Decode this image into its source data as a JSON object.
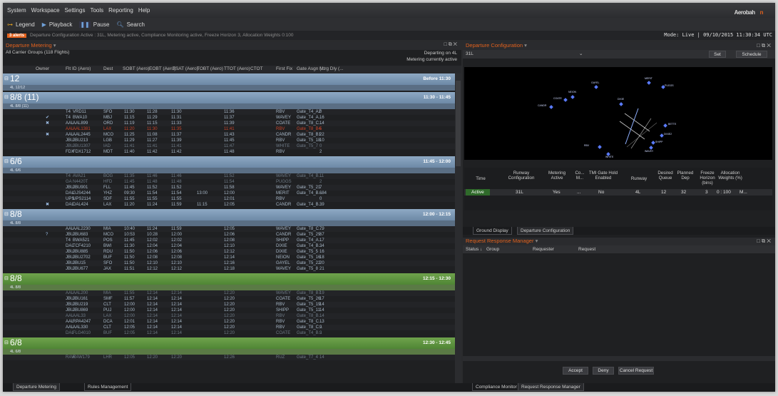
{
  "menu": [
    "System",
    "Workspace",
    "Settings",
    "Tools",
    "Reporting",
    "Help"
  ],
  "brand": {
    "prefix": "Aerobah",
    "suffix": "n"
  },
  "toolbar": {
    "legend": "Legend",
    "playback": "Playback",
    "pause": "Pause",
    "search": "Search"
  },
  "status": {
    "alert": "3 alerts",
    "text": "Departure Configuration Active : 31L, Metering active, Compliance Monitoring active, Freeze Horizon 3, Allocation Weights 0:100",
    "mode": "Mode: Live  |  09/10/2015 11:30:34 UTC"
  },
  "left": {
    "title": "Departure Metering",
    "controls": "□ ⧉ ✕",
    "subtitle": "All Carrier Groups (118 Flights)",
    "departing": "Departing on 4L",
    "metering": "Metering currently active",
    "columns": [
      "Owner",
      "Flt ID (Aero)",
      "Dest",
      "SOBT (Aero)",
      "EOBT (Aero)",
      "TSAT (Aero)",
      "TOBT (Aero)",
      "TTOT (Aero)",
      "CTOT",
      "First Fix",
      "Gate Asgn (...",
      "Mtrg Dly (..."
    ],
    "groups": [
      {
        "title": "12",
        "range": "Before 11:30",
        "sub": "4L  12/12",
        "color": "blue",
        "rows": []
      },
      {
        "title": "8/8 (11)",
        "range": "11:30 - 11:45",
        "sub": "4L  8/8 (11)",
        "color": "blue",
        "rows": [
          [
            "",
            "T4",
            "VRD11",
            "SFO",
            "11:30",
            "11:28",
            "11:30",
            "",
            "11:36",
            "",
            "RBV",
            "Gate_T4_A2",
            "0",
            ""
          ],
          [
            "✔",
            "T4",
            "BWA10",
            "MBJ",
            "11:15",
            "11:29",
            "11:31",
            "",
            "11:37",
            "",
            "WAVEY",
            "Gate_T4_A...",
            "16",
            ""
          ],
          [
            "✖",
            "AAL",
            "AAL899",
            "ORD",
            "11:19",
            "11:15",
            "11:33",
            "",
            "11:39",
            "",
            "COATE",
            "Gate_T8_C...",
            "14",
            ""
          ],
          [
            "",
            "AAL",
            "AAL1381",
            "LAX",
            "11:20",
            "11:30",
            "11:35",
            "",
            "11:41",
            "",
            "RBV",
            "Gate_T8_B4",
            "5",
            "red"
          ],
          [
            "✖",
            "AAL",
            "AAL2445",
            "MCO",
            "11:25",
            "11:08",
            "11:37",
            "",
            "11:43",
            "",
            "CANDR",
            "Gate_T8_B1",
            "22",
            ""
          ],
          [
            "",
            "JBU",
            "JBU213",
            "LGB",
            "11:29",
            "11:27",
            "11:39",
            "",
            "11:45",
            "",
            "RBV",
            "Gate_T5_18",
            "10",
            ""
          ],
          [
            "",
            "JBU",
            "JBU1307",
            "IAD",
            "11:41",
            "11:41",
            "11:41",
            "",
            "11:47",
            "",
            "WHITE",
            "Gate_T5_7",
            "0",
            "dim"
          ],
          [
            "",
            "FDX",
            "FDX1712",
            "MDT",
            "11:40",
            "11:42",
            "11:42",
            "",
            "11:48",
            "",
            "RBV",
            "",
            "2",
            ""
          ]
        ]
      },
      {
        "title": "6/6",
        "range": "11:45 - 12:00",
        "sub": "4L  6/6",
        "color": "blue",
        "rows": [
          [
            "",
            "T4",
            "AVA21",
            "BOG",
            "11:35",
            "11:46",
            "11:46",
            "",
            "11:52",
            "",
            "WAVEY",
            "Gate_T4_B...",
            "11",
            "dim"
          ],
          [
            "",
            "GA",
            "N4420T",
            "HFD",
            "11:45",
            "11:48",
            "11:48",
            "",
            "11:54",
            "",
            "PUGGS",
            "",
            "2",
            "dim"
          ],
          [
            "",
            "JBU",
            "JBU901",
            "FLL",
            "11:45",
            "11:52",
            "11:52",
            "",
            "11:58",
            "",
            "WAVEY",
            "Gate_T5_21",
            "7",
            ""
          ],
          [
            "",
            "DAL",
            "GJS4244",
            "YHZ",
            "09:30",
            "11:54",
            "11:54",
            "13:00",
            "12:00",
            "",
            "MERIT",
            "Gate_T4_B...",
            "684",
            ""
          ],
          [
            "",
            "UPS",
            "UPS2114",
            "SDF",
            "11:55",
            "11:55",
            "11:55",
            "",
            "12:01",
            "",
            "RBV",
            "",
            "0",
            ""
          ],
          [
            "✖",
            "DAL",
            "DAL424",
            "LAX",
            "11:20",
            "11:24",
            "11:59",
            "11:15",
            "12:05",
            "",
            "CANDR",
            "Gate_T4_B...",
            "39",
            ""
          ]
        ]
      },
      {
        "title": "8/8",
        "range": "12:00 - 12:15",
        "sub": "4L  8/8",
        "color": "blue",
        "rows": [
          [
            "",
            "AAL",
            "AAL2230",
            "MIA",
            "10:40",
            "11:24",
            "11:59",
            "",
            "12:05",
            "",
            "WAVEY",
            "Gate_T8_C...",
            "79",
            ""
          ],
          [
            "?",
            "JBU",
            "JBU683",
            "MCO",
            "10:53",
            "10:28",
            "12:00",
            "",
            "12:06",
            "",
            "CANDR",
            "Gate_T5_29",
            "67",
            ""
          ],
          [
            "",
            "T4",
            "BWA521",
            "POS",
            "11:45",
            "12:02",
            "12:02",
            "",
            "12:08",
            "",
            "SHIPP",
            "Gate_T4_A...",
            "17",
            ""
          ],
          [
            "",
            "DAL",
            "TCF4210",
            "BWI",
            "11:30",
            "12:04",
            "12:04",
            "",
            "12:10",
            "",
            "DIXIE",
            "Gate_T4_B...",
            "34",
            ""
          ],
          [
            "",
            "JBU",
            "JBU885",
            "RDU",
            "11:50",
            "12:06",
            "12:06",
            "",
            "12:12",
            "",
            "DIXIE",
            "Gate_T5_5",
            "16",
            ""
          ],
          [
            "",
            "JBU",
            "JBU2702",
            "BUF",
            "11:50",
            "12:08",
            "12:08",
            "",
            "12:14",
            "",
            "NEION",
            "Gate_T5_16",
            "18",
            ""
          ],
          [
            "",
            "JBU",
            "JBU15",
            "SFO",
            "11:50",
            "12:10",
            "12:10",
            "",
            "12:16",
            "",
            "GAYEL",
            "Gate_T5_22",
            "20",
            ""
          ],
          [
            "",
            "JBU",
            "JBU677",
            "JAX",
            "11:51",
            "12:12",
            "12:12",
            "",
            "12:18",
            "",
            "WAVEY",
            "Gate_T5_8",
            "21",
            ""
          ]
        ]
      },
      {
        "title": "8/8",
        "range": "12:15 - 12:30",
        "sub": "4L  8/8",
        "color": "green",
        "rows": [
          [
            "",
            "AAL",
            "AAL200",
            "MIA",
            "11:55",
            "12:14",
            "12:14",
            "",
            "12:20",
            "",
            "WAVEY",
            "Gate_T8_B7",
            "19",
            "dim"
          ],
          [
            "",
            "JBU",
            "JBU161",
            "SMF",
            "11:57",
            "12:14",
            "12:14",
            "",
            "12:20",
            "",
            "COATE",
            "Gate_T5_26",
            "17",
            ""
          ],
          [
            "",
            "JBU",
            "JBU219",
            "CLT",
            "12:00",
            "12:14",
            "12:14",
            "",
            "12:20",
            "",
            "RBV",
            "Gate_T5_19",
            "14",
            ""
          ],
          [
            "",
            "JBU",
            "JBU869",
            "PUJ",
            "12:00",
            "12:14",
            "12:14",
            "",
            "12:20",
            "",
            "SHIPP",
            "Gate_T5_11",
            "14",
            ""
          ],
          [
            "",
            "AAL",
            "AAL33",
            "LAX",
            "12:00",
            "12:14",
            "12:14",
            "",
            "12:20",
            "",
            "RBV",
            "Gate_T8_B...",
            "14",
            "dim"
          ],
          [
            "",
            "AAL",
            "RPA4247",
            "DCA",
            "12:01",
            "12:14",
            "12:14",
            "",
            "12:20",
            "",
            "RBV",
            "Gate_T8_C...",
            "13",
            ""
          ],
          [
            "",
            "AAL",
            "AAL330",
            "CLT",
            "12:05",
            "12:14",
            "12:14",
            "",
            "12:20",
            "",
            "RBV",
            "Gate_T8_C...",
            "9",
            ""
          ],
          [
            "",
            "DAL",
            "FLG4010",
            "BUF",
            "12:05",
            "12:14",
            "12:14",
            "",
            "12:20",
            "",
            "COATE",
            "Gate_T4_B...",
            "9",
            "dim"
          ]
        ]
      },
      {
        "title": "6/8",
        "range": "12:30 - 12:45",
        "sub": "4L  6/8",
        "color": "green",
        "rows": [
          [
            "",
            "RAW",
            "RAW179",
            "LHR",
            "12:05",
            "12:20",
            "12:20",
            "",
            "12:26",
            "",
            "RUZ",
            "Gate_T7_4",
            "14",
            "dim"
          ]
        ]
      }
    ]
  },
  "right": {
    "title": "Departure Configuration",
    "controls": "□ ⧉ ✕",
    "runway": "31L",
    "set": "Set",
    "schedule": "Schedule",
    "fixes": [
      "GAYEL",
      "NEION",
      "COATE",
      "CANDR",
      "DIXIE",
      "RBV",
      "WHITE",
      "MERIT",
      "SHIPP",
      "WAVEY",
      "PUGGS",
      "BETTE",
      "DIXIE2"
    ],
    "table_headers": [
      "Time",
      "Runway Configuration",
      "Metering Active",
      "Co... M...",
      "TMI Gate Hold Enabled",
      "Runway",
      "Desired Queue",
      "Planned Dep",
      "Freeze Horizon (bins)",
      "Allocation Weights (%)"
    ],
    "table_row": [
      "Active",
      "31L",
      "Yes",
      "...",
      "No",
      "4L",
      "12",
      "32",
      "3",
      "0 : 100",
      "M..."
    ],
    "tabs": [
      "Ground Display",
      "Departure Configuration"
    ],
    "rrm_title": "Request Response Manager",
    "rrm_columns": [
      "Status",
      "Group",
      "Requester",
      "Request"
    ],
    "accept": "Accept",
    "deny": "Deny",
    "cancel": "Cancel Request",
    "bottom_tabs": [
      "Compliance Monitor",
      "Request Response Manager"
    ]
  },
  "bottom_left_tabs": [
    "Departure Metering",
    "Rules Management"
  ],
  "colors": {
    "accent": "#e3621d",
    "group_blue": "#7f9bb8",
    "group_green": "#5e9440",
    "active_green": "#2f6a2a"
  }
}
